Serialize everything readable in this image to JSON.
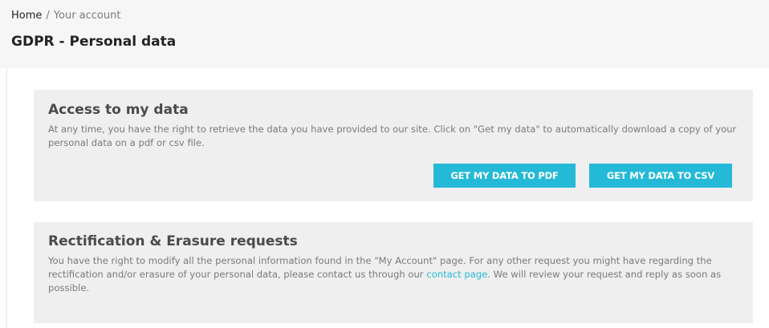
{
  "breadcrumb": {
    "home": "Home",
    "separator": "/",
    "current": "Your account"
  },
  "page": {
    "title": "GDPR - Personal data"
  },
  "access": {
    "title": "Access to my data",
    "description": "At any time, you have the right to retrieve the data you have provided to our site. Click on \"Get my data\" to automatically download a copy of your personal data on a pdf or csv file.",
    "pdf_button": "GET MY DATA TO PDF",
    "csv_button": "GET MY DATA TO CSV"
  },
  "rectification": {
    "title": "Rectification & Erasure requests",
    "description_before": "You have the right to modify all the personal information found in the \"My Account\" page. For any other request you might have regarding the rectification and/or erasure of your personal data, please contact us through our ",
    "contact_link": "contact page",
    "description_after": ". We will review your request and reply as soon as possible."
  },
  "colors": {
    "accent": "#24b9d7",
    "card_background": "#efefef",
    "header_background": "#f6f6f6"
  }
}
